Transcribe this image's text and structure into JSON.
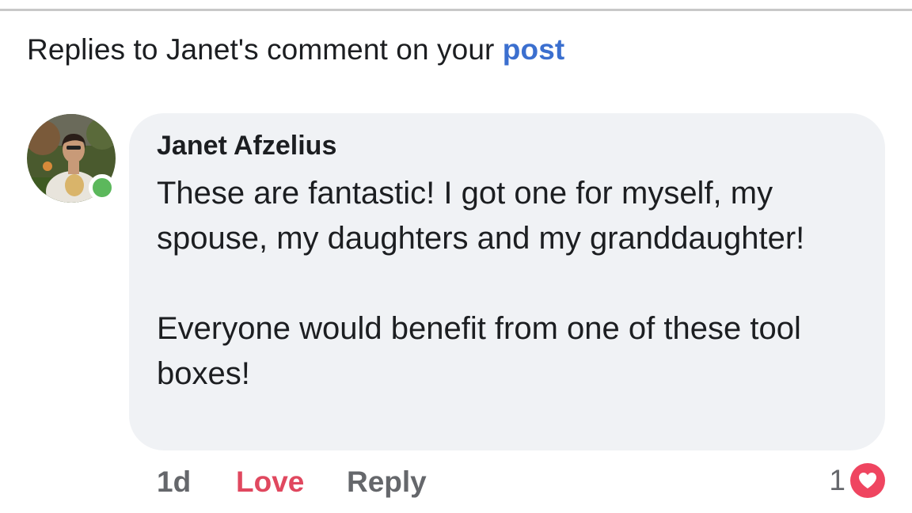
{
  "header": {
    "prefix": "Replies to Janet's comment on your ",
    "link": "post"
  },
  "comment": {
    "author": "Janet Afzelius",
    "paragraphs": [
      "These are fantastic! I got one for myself, my spouse, my daughters and my granddaughter!",
      "Everyone would benefit from one of these tool boxes!"
    ],
    "online_color": "#5cb85c"
  },
  "actions": {
    "time": "1d",
    "love": "Love",
    "reply": "Reply"
  },
  "reactions": {
    "count": "1",
    "icon": "heart-icon",
    "color": "#ef4560"
  },
  "colors": {
    "link": "#3b6fcf",
    "love": "#e0485f",
    "bubble": "#f0f2f5",
    "muted": "#65676b"
  }
}
